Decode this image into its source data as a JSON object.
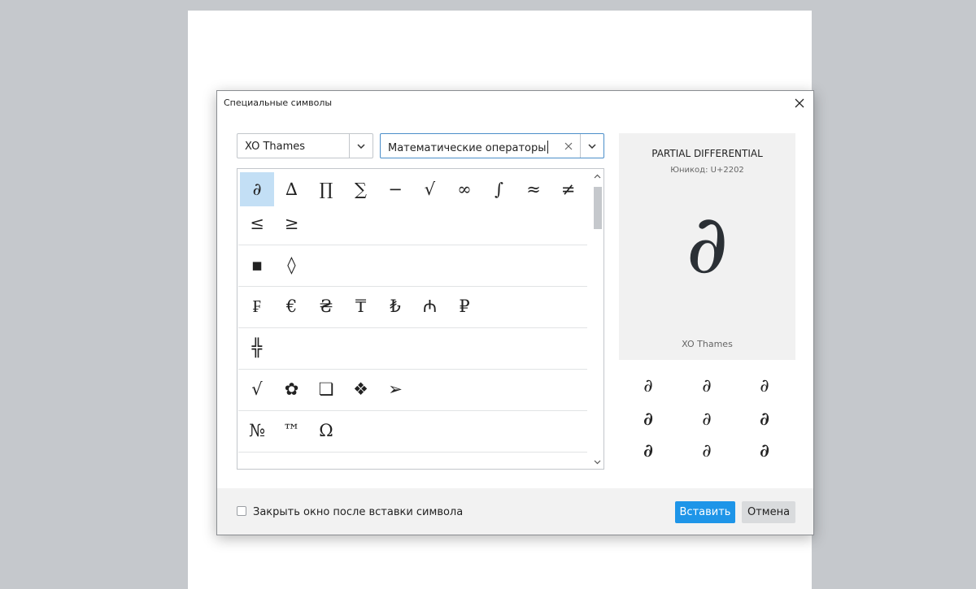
{
  "dialog": {
    "title": "Специальные символы"
  },
  "font_select": {
    "value": "XO Thames"
  },
  "range_select": {
    "value": "Математические операторы"
  },
  "symbol_rows": [
    {
      "symbols": [
        "∂",
        "∆",
        "∏",
        "∑",
        "−",
        "√",
        "∞",
        "∫",
        "≈",
        "≠"
      ]
    },
    {
      "symbols": [
        "≤",
        "≥"
      ]
    },
    {
      "symbols": [
        "▪",
        "◊"
      ]
    },
    {
      "symbols": [
        "₣",
        "€",
        "₴",
        "₸",
        "₺",
        "₼",
        "₽"
      ]
    },
    {
      "symbols": [
        "╬"
      ]
    },
    {
      "symbols": [
        "√",
        "✿",
        "❏",
        "❖",
        "➢"
      ]
    },
    {
      "symbols": [
        "№",
        "™",
        "Ω"
      ]
    }
  ],
  "selected_symbol": "∂",
  "preview": {
    "name": "PARTIAL DIFFERENTIAL",
    "code": "Юникод: U+2202",
    "glyph": "∂",
    "font": "XO Thames"
  },
  "variants": [
    "∂",
    "∂",
    "∂",
    "∂",
    "∂",
    "∂",
    "∂",
    "∂",
    "∂"
  ],
  "footer": {
    "checkbox_label": "Закрыть окно после вставки символа",
    "checkbox_checked": false,
    "insert_label": "Вставить",
    "cancel_label": "Отмена"
  }
}
